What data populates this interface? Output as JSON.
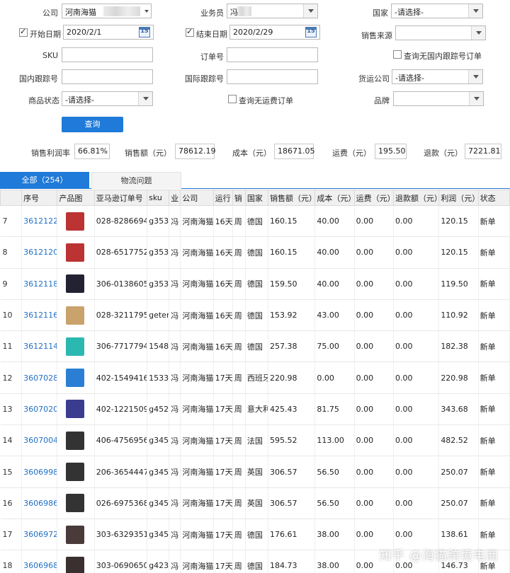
{
  "filters": {
    "company": {
      "label": "公司",
      "value": "河南海猫"
    },
    "salesperson": {
      "label": "业务员",
      "value": "冯"
    },
    "country": {
      "label": "国家",
      "value": "-请选择-"
    },
    "start_date": {
      "label": "开始日期",
      "value": "2020/2/1",
      "checked": true
    },
    "end_date": {
      "label": "结束日期",
      "value": "2020/2/29",
      "checked": true
    },
    "sales_source": {
      "label": "销售来源",
      "value": ""
    },
    "sku": {
      "label": "SKU",
      "value": ""
    },
    "order_no": {
      "label": "订单号",
      "value": ""
    },
    "no_domestic_tracking": {
      "label": "查询无国内跟踪号订单",
      "checked": false
    },
    "domestic_tracking": {
      "label": "国内跟踪号",
      "value": ""
    },
    "intl_tracking": {
      "label": "国际跟踪号",
      "value": ""
    },
    "freight_company": {
      "label": "货运公司",
      "value": "-请选择-"
    },
    "product_status": {
      "label": "商品状态",
      "value": "-请选择-"
    },
    "no_freight_orders": {
      "label": "查询无运费订单",
      "checked": false
    },
    "brand": {
      "label": "品牌",
      "value": ""
    },
    "calendar_icon_text": "15",
    "query_button": "查询"
  },
  "summary": {
    "profit_margin_label": "销售利润率",
    "profit_margin": "66.81%",
    "sales_label": "销售额（元）",
    "sales": "78612.19",
    "cost_label": "成本（元）",
    "cost": "18671.05",
    "freight_label": "运费（元）",
    "freight": "195.50",
    "refund_label": "退款（元）",
    "refund": "7221.81"
  },
  "tabs": [
    {
      "label": "全部（254）",
      "active": true
    },
    {
      "label": "物流问题",
      "active": false
    }
  ],
  "table": {
    "columns": [
      "序号",
      "产品图",
      "亚马逊订单号",
      "sku",
      "业",
      "公司",
      "运行",
      "销",
      "国家",
      "销售额（元）",
      "成本（元）",
      "运费（元）",
      "退款额（元）",
      "利润（元）",
      "状态"
    ],
    "rows": [
      {
        "n": "7",
        "id": "3612122",
        "thumb": "#b33",
        "order": "028-8286694-",
        "sku": "g353",
        "biz": "冯",
        "company": "河南海猫",
        "run": "16天",
        "sale": "周",
        "country": "德国",
        "sales": "160.15",
        "cost": "40.00",
        "freight": "0.00",
        "refund": "0.00",
        "profit": "120.15",
        "status": "新单"
      },
      {
        "n": "8",
        "id": "3612120",
        "thumb": "#b33",
        "order": "028-6517752-",
        "sku": "g353",
        "biz": "冯",
        "company": "河南海猫",
        "run": "16天",
        "sale": "周",
        "country": "德国",
        "sales": "160.15",
        "cost": "40.00",
        "freight": "0.00",
        "refund": "0.00",
        "profit": "120.15",
        "status": "新单"
      },
      {
        "n": "9",
        "id": "3612118",
        "thumb": "#223",
        "order": "306-0138605-",
        "sku": "g353",
        "biz": "冯",
        "company": "河南海猫",
        "run": "16天",
        "sale": "周",
        "country": "德国",
        "sales": "159.50",
        "cost": "40.00",
        "freight": "0.00",
        "refund": "0.00",
        "profit": "119.50",
        "status": "新单"
      },
      {
        "n": "10",
        "id": "3612116",
        "thumb": "#c9a36b",
        "order": "028-3211795-",
        "sku": "geter",
        "biz": "冯",
        "company": "河南海猫",
        "run": "16天",
        "sale": "周",
        "country": "德国",
        "sales": "153.92",
        "cost": "43.00",
        "freight": "0.00",
        "refund": "0.00",
        "profit": "110.92",
        "status": "新单"
      },
      {
        "n": "11",
        "id": "3612114",
        "thumb": "#2bb8b0",
        "order": "306-7717794-",
        "sku": "1548",
        "biz": "冯",
        "company": "河南海猫",
        "run": "16天",
        "sale": "周",
        "country": "德国",
        "sales": "257.38",
        "cost": "75.00",
        "freight": "0.00",
        "refund": "0.00",
        "profit": "182.38",
        "status": "新单"
      },
      {
        "n": "12",
        "id": "3607028",
        "thumb": "#2a7fd4",
        "order": "402-1549416-",
        "sku": "1533",
        "biz": "冯",
        "company": "河南海猫",
        "run": "17天",
        "sale": "周",
        "country": "西班牙",
        "sales": "220.98",
        "cost": "0.00",
        "freight": "0.00",
        "refund": "0.00",
        "profit": "220.98",
        "status": "新单"
      },
      {
        "n": "13",
        "id": "3607020",
        "thumb": "#3a3d8f",
        "order": "402-1221509-",
        "sku": "g452",
        "biz": "冯",
        "company": "河南海猫",
        "run": "17天",
        "sale": "周",
        "country": "意大利",
        "sales": "425.43",
        "cost": "81.75",
        "freight": "0.00",
        "refund": "0.00",
        "profit": "343.68",
        "status": "新单"
      },
      {
        "n": "14",
        "id": "3607004",
        "thumb": "#333",
        "order": "406-4756956-",
        "sku": "g345",
        "biz": "冯",
        "company": "河南海猫",
        "run": "17天",
        "sale": "周",
        "country": "法国",
        "sales": "595.52",
        "cost": "113.00",
        "freight": "0.00",
        "refund": "0.00",
        "profit": "482.52",
        "status": "新单"
      },
      {
        "n": "15",
        "id": "3606998",
        "thumb": "#333",
        "order": "206-3654447-",
        "sku": "g345",
        "biz": "冯",
        "company": "河南海猫",
        "run": "17天",
        "sale": "周",
        "country": "英国",
        "sales": "306.57",
        "cost": "56.50",
        "freight": "0.00",
        "refund": "0.00",
        "profit": "250.07",
        "status": "新单"
      },
      {
        "n": "16",
        "id": "3606986",
        "thumb": "#333",
        "order": "026-6975368-",
        "sku": "g345",
        "biz": "冯",
        "company": "河南海猫",
        "run": "17天",
        "sale": "周",
        "country": "英国",
        "sales": "306.57",
        "cost": "56.50",
        "freight": "0.00",
        "refund": "0.00",
        "profit": "250.07",
        "status": "新单"
      },
      {
        "n": "17",
        "id": "3606972",
        "thumb": "#4a3a3a",
        "order": "303-6329351-",
        "sku": "g345",
        "biz": "冯",
        "company": "河南海猫",
        "run": "17天",
        "sale": "周",
        "country": "德国",
        "sales": "176.61",
        "cost": "38.00",
        "freight": "0.00",
        "refund": "0.00",
        "profit": "138.61",
        "status": "新单"
      },
      {
        "n": "18",
        "id": "3606968",
        "thumb": "#3a3030",
        "order": "303-0690650-",
        "sku": "g423",
        "biz": "冯",
        "company": "河南海猫",
        "run": "17天",
        "sale": "周",
        "country": "德国",
        "sales": "184.73",
        "cost": "38.00",
        "freight": "0.00",
        "refund": "0.00",
        "profit": "146.73",
        "status": "新单"
      }
    ]
  },
  "watermark": "知乎 @海猫跨境电商"
}
